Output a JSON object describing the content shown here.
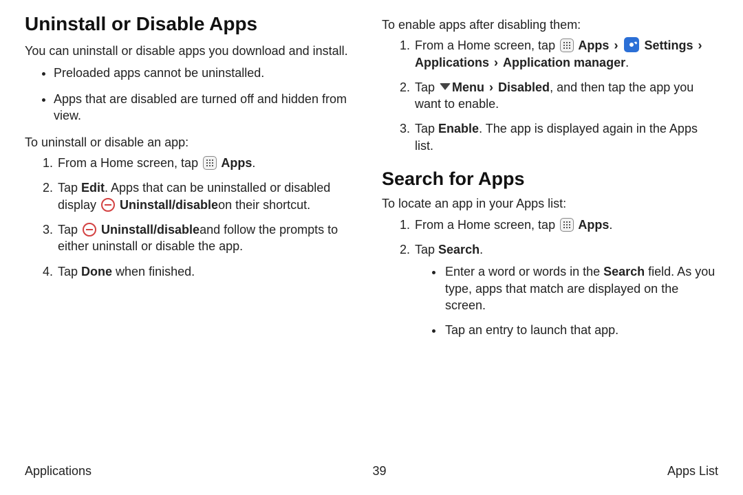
{
  "left": {
    "heading": "Uninstall or Disable Apps",
    "intro": "You can uninstall or disable apps you download and install.",
    "bullets": [
      "Preloaded apps cannot be uninstalled.",
      "Apps that are disabled are turned off and hidden from view."
    ],
    "subhead": "To uninstall or disable an app:",
    "step1_a": "From a Home screen, tap ",
    "step1_b": " Apps",
    "step1_c": ".",
    "step2_a": "Tap ",
    "step2_b": "Edit",
    "step2_c": ". Apps that can be uninstalled or disabled display ",
    "step2_d": " Uninstall/disable",
    "step2_e": "on their  shortcut.",
    "step3_a": "Tap ",
    "step3_b": " Uninstall/disable",
    "step3_c": "and follow  the prompts to either uninstall or disable the app.",
    "step4_a": "Tap ",
    "step4_b": "Done",
    "step4_c": " when finished."
  },
  "right": {
    "enable_head": "To enable apps after disabling them:",
    "e1_a": "From a Home screen, tap ",
    "e1_b": " Apps",
    "e1_chev": "›",
    "e1_c": " Settings",
    "e1_d": "Applications",
    "e1_e": "Application manager",
    "e1_f": ".",
    "e2_a": "Tap ",
    "e2_b": "Menu ",
    "e2_chev": "›",
    "e2_c": " Disabled",
    "e2_d": ", and then tap the app you want to enable.",
    "e3_a": "Tap ",
    "e3_b": "Enable",
    "e3_c": ". The app is displayed again in the Apps list.",
    "heading2": "Search for Apps",
    "s_intro": "To locate an app in your Apps list:",
    "s1_a": "From a Home screen, tap ",
    "s1_b": " Apps",
    "s1_c": ".",
    "s2_a": "Tap ",
    "s2_b": "Search",
    "s2_c": ".",
    "s2_sub1_a": "Enter a word or words in the ",
    "s2_sub1_b": "Search",
    "s2_sub1_c": " field. As you type, apps that match are displayed on the screen.",
    "s2_sub2": "Tap an entry to launch that app."
  },
  "footer": {
    "left": "Applications",
    "center": "39",
    "right": "Apps List"
  }
}
